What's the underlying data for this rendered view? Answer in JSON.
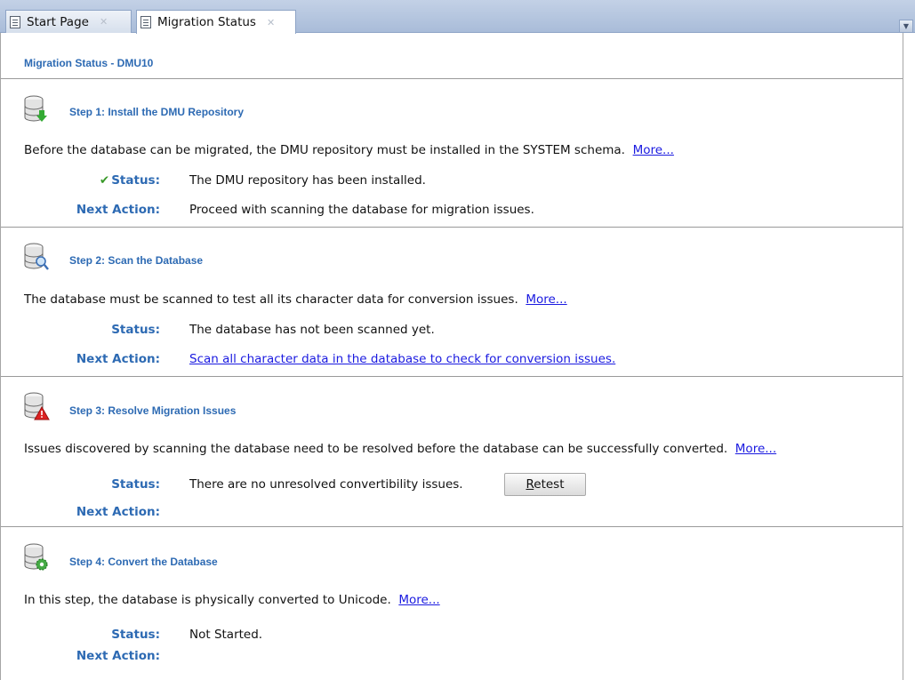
{
  "tabs": [
    {
      "label": "Start Page",
      "active": false
    },
    {
      "label": "Migration Status",
      "active": true
    }
  ],
  "page_title": "Migration Status - DMU10",
  "steps": [
    {
      "title": "Step 1: Install the DMU Repository",
      "icon": "database-download-icon",
      "description": "Before the database can be migrated, the DMU repository must be installed in the SYSTEM schema.",
      "more": "More...",
      "status_label": "Status:",
      "status": "The DMU repository has been installed.",
      "next_label": "Next Action:",
      "next_action": "Proceed with scanning the database for migration issues."
    },
    {
      "title": "Step 2: Scan the Database",
      "icon": "database-search-icon",
      "description": "The database must be scanned to test all its character data for conversion issues.",
      "more": "More...",
      "status_label": "Status:",
      "status": "The database has not been scanned yet.",
      "next_label": "Next Action:",
      "next_action": "Scan all character data in the database to check for conversion issues."
    },
    {
      "title": "Step 3: Resolve Migration Issues",
      "icon": "database-warning-icon",
      "description": "Issues discovered by scanning the database need to be resolved before the database can be successfully converted.",
      "more": "More...",
      "status_label": "Status:",
      "status": "There are no unresolved convertibility issues.",
      "retest_prefix": "",
      "retest_underlined": "R",
      "retest_rest": "etest",
      "next_label": "Next Action:",
      "next_action": ""
    },
    {
      "title": "Step 4: Convert the Database",
      "icon": "database-gear-icon",
      "description": "In this step, the database is physically converted to Unicode.",
      "more": "More...",
      "status_label": "Status:",
      "status": "Not Started.",
      "next_label": "Next Action:",
      "next_action": ""
    }
  ],
  "colors": {
    "heading": "#2d6ab3",
    "link": "#1a1ae0",
    "check": "#3a9a2a"
  }
}
